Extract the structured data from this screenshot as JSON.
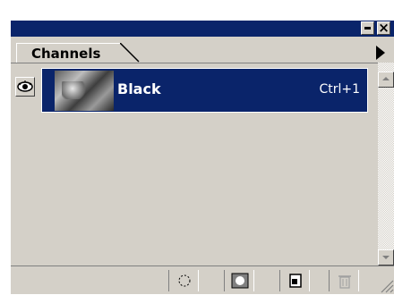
{
  "window": {
    "minimize_icon": "minimize-icon",
    "close_glyph": "×"
  },
  "tabs": [
    {
      "label": "Channels"
    }
  ],
  "channels": [
    {
      "name": "Black",
      "shortcut": "Ctrl+1",
      "visible": true,
      "selected": true
    }
  ],
  "footer_buttons": [
    {
      "icon": "load-channel-as-selection-icon"
    },
    {
      "icon": "save-selection-as-channel-icon"
    },
    {
      "icon": "new-channel-icon"
    },
    {
      "icon": "delete-channel-icon"
    }
  ],
  "colors": {
    "titlebar": "#0a246a",
    "selection": "#0a246a",
    "panel": "#d4d0c8"
  }
}
